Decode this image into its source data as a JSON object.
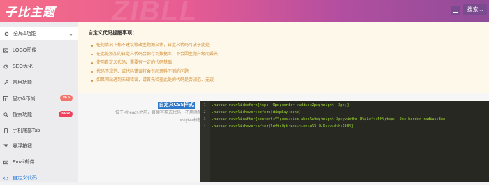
{
  "header": {
    "brand": "子比主题",
    "watermark": "ZIBLL",
    "search_label": "搜索..."
  },
  "sidebar": {
    "top_item": "全局&功能",
    "items": [
      {
        "label": "LOGO图像",
        "icon": "image-icon"
      },
      {
        "label": "SEO优化",
        "icon": "seo-icon"
      },
      {
        "label": "常用功能",
        "icon": "wrench-icon"
      },
      {
        "label": "显示&布局",
        "icon": "layout-icon",
        "badge": "V6.6"
      },
      {
        "label": "搜索功能",
        "icon": "search-icon",
        "badge": "NEW"
      },
      {
        "label": "手机底部Tab",
        "icon": "mobile-icon"
      },
      {
        "label": "悬浮按钮",
        "icon": "pin-icon"
      },
      {
        "label": "Email邮件",
        "icon": "mail-icon"
      },
      {
        "label": "自定义代码",
        "icon": "code-icon",
        "active": true
      }
    ]
  },
  "notice": {
    "title": "自定义代码提醒事项：",
    "items": [
      "任何情况下都不建议修改主题源文件，自定义代码可放于此处",
      "在此处添加的自定义代码会保存到数据库，不会因主题升级而丢失",
      "使用自定义代码，需要有一定的代码基础",
      "代码不规范、或代码错误将会引起意料不到的问题",
      "如果网站遇到未知错误，请首先检查此处的代码是否规范、无误"
    ]
  },
  "setting": {
    "title": "自定义CSS样式",
    "desc_line1": "位于</head>之前，直接写样式代码，不用添加",
    "desc_line2": "<style>标签",
    "code_lines": [
      ".navbar-nav>li:before{top: -9px;border-radius:2px;height: 3px;}",
      ".navbar-nav>li:hover:before{display:none}",
      ".navbar-nav>li:after{content:\"\";position:absolute;height:3px;width: 0%;left:50%;top: -9px;border-radius:3px",
      ".navbar-nav>li:hover:after{left:0;transition:all 0.6s;width:100%}"
    ]
  },
  "colors": {
    "accent": "#2e78c9",
    "notice_text": "#d28f3a",
    "editor_bg": "#272822",
    "code_green": "#a6e22e"
  }
}
